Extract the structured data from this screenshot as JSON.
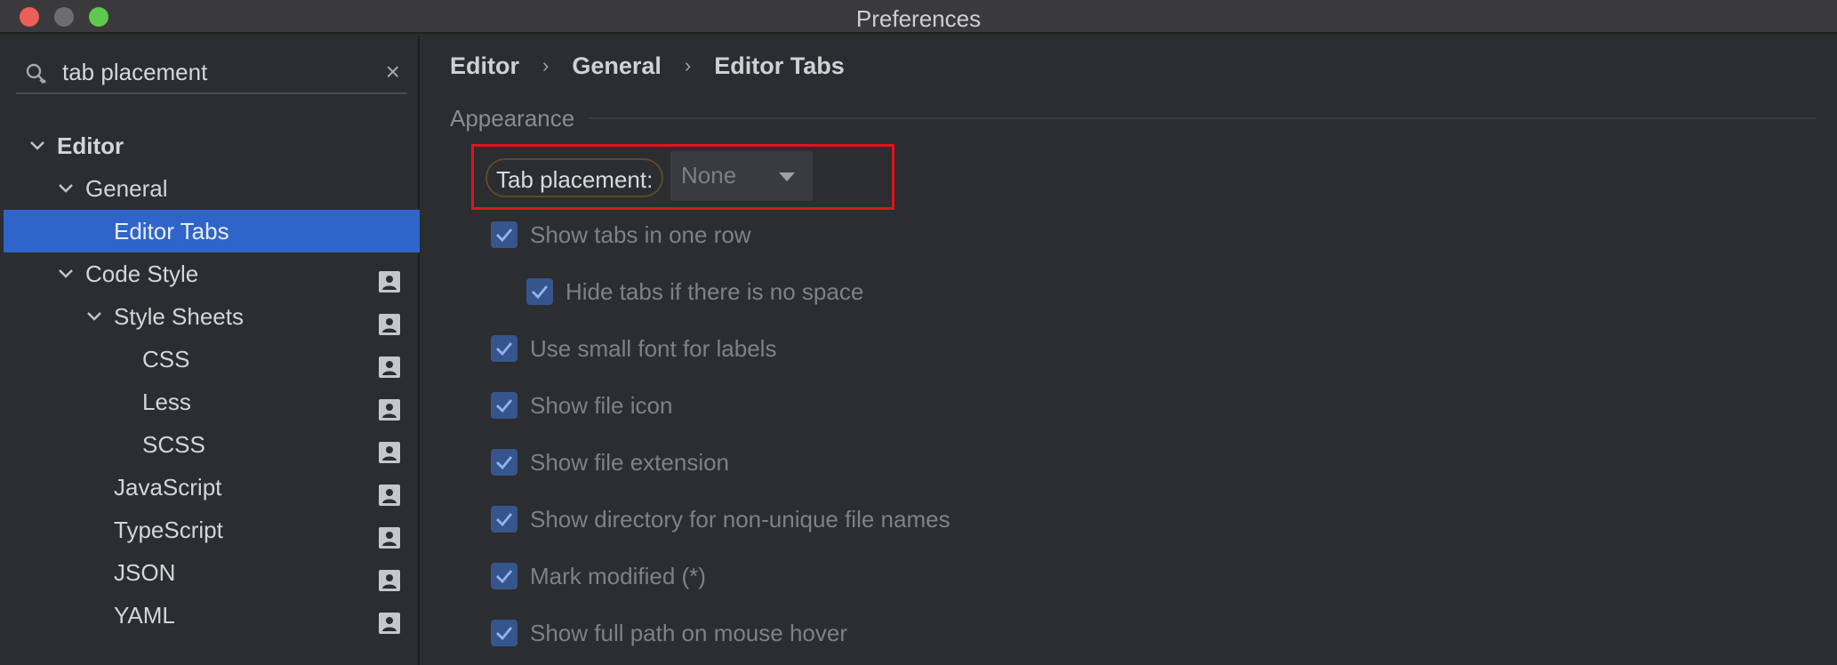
{
  "window": {
    "title": "Preferences"
  },
  "search": {
    "value": "tab placement",
    "placeholder": ""
  },
  "tree": [
    {
      "label": "Editor",
      "bold": true,
      "expanded": true
    },
    {
      "label": "General",
      "expanded": true
    },
    {
      "label": "Editor Tabs",
      "selected": true
    },
    {
      "label": "Code Style",
      "expanded": true,
      "profile": true
    },
    {
      "label": "Style Sheets",
      "expanded": true,
      "profile": true
    },
    {
      "label": "CSS",
      "profile": true
    },
    {
      "label": "Less",
      "profile": true
    },
    {
      "label": "SCSS",
      "profile": true
    },
    {
      "label": "JavaScript",
      "profile": true
    },
    {
      "label": "TypeScript",
      "profile": true
    },
    {
      "label": "JSON",
      "profile": true
    },
    {
      "label": "YAML",
      "profile": true
    }
  ],
  "breadcrumb": [
    "Editor",
    "General",
    "Editor Tabs"
  ],
  "section": {
    "title": "Appearance"
  },
  "tab_placement": {
    "label": "Tab placement:",
    "value": "None"
  },
  "checkboxes": [
    {
      "label": "Show tabs in one row",
      "checked": true
    },
    {
      "label": "Hide tabs if there is no space",
      "checked": true,
      "indent": true
    },
    {
      "label": "Use small font for labels",
      "checked": true
    },
    {
      "label": "Show file icon",
      "checked": true
    },
    {
      "label": "Show file extension",
      "checked": true
    },
    {
      "label": "Show directory for non-unique file names",
      "checked": true
    },
    {
      "label": "Mark modified (*)",
      "checked": true
    },
    {
      "label": "Show full path on mouse hover",
      "checked": true
    }
  ],
  "colors": {
    "selection": "#2f65ca",
    "highlight_box": "#e1141a",
    "checkbox": "#36558d"
  }
}
